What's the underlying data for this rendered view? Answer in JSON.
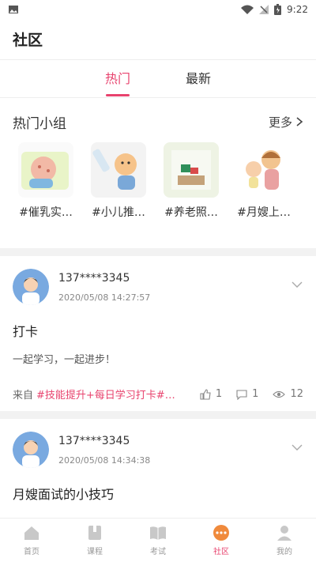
{
  "status": {
    "time": "9:22"
  },
  "header": {
    "title": "社区"
  },
  "tabs": [
    {
      "label": "热门"
    },
    {
      "label": "最新"
    }
  ],
  "hot_groups": {
    "title": "热门小组",
    "more_label": "更多",
    "items": [
      {
        "name": "#催乳实…"
      },
      {
        "name": "#小儿推…"
      },
      {
        "name": "#养老照…"
      },
      {
        "name": "#月嫂上…"
      }
    ]
  },
  "posts": [
    {
      "user": "137****3345",
      "time": "2020/05/08 14:27:57",
      "title": "打卡",
      "body": "一起学习，一起进步！",
      "from_label": "来自",
      "tags": "#技能提升+每日学习打卡#…",
      "likes": "1",
      "comments": "1",
      "views": "12"
    },
    {
      "user": "137****3345",
      "time": "2020/05/08 14:34:38",
      "title": "月嫂面试的小技巧"
    }
  ],
  "nav": [
    {
      "label": "首页",
      "icon": "home-icon"
    },
    {
      "label": "课程",
      "icon": "book-icon"
    },
    {
      "label": "考试",
      "icon": "exam-icon"
    },
    {
      "label": "社区",
      "icon": "community-icon"
    },
    {
      "label": "我的",
      "icon": "profile-icon"
    }
  ],
  "colors": {
    "accent": "#e8436e",
    "divider": "#f2f2f2"
  }
}
